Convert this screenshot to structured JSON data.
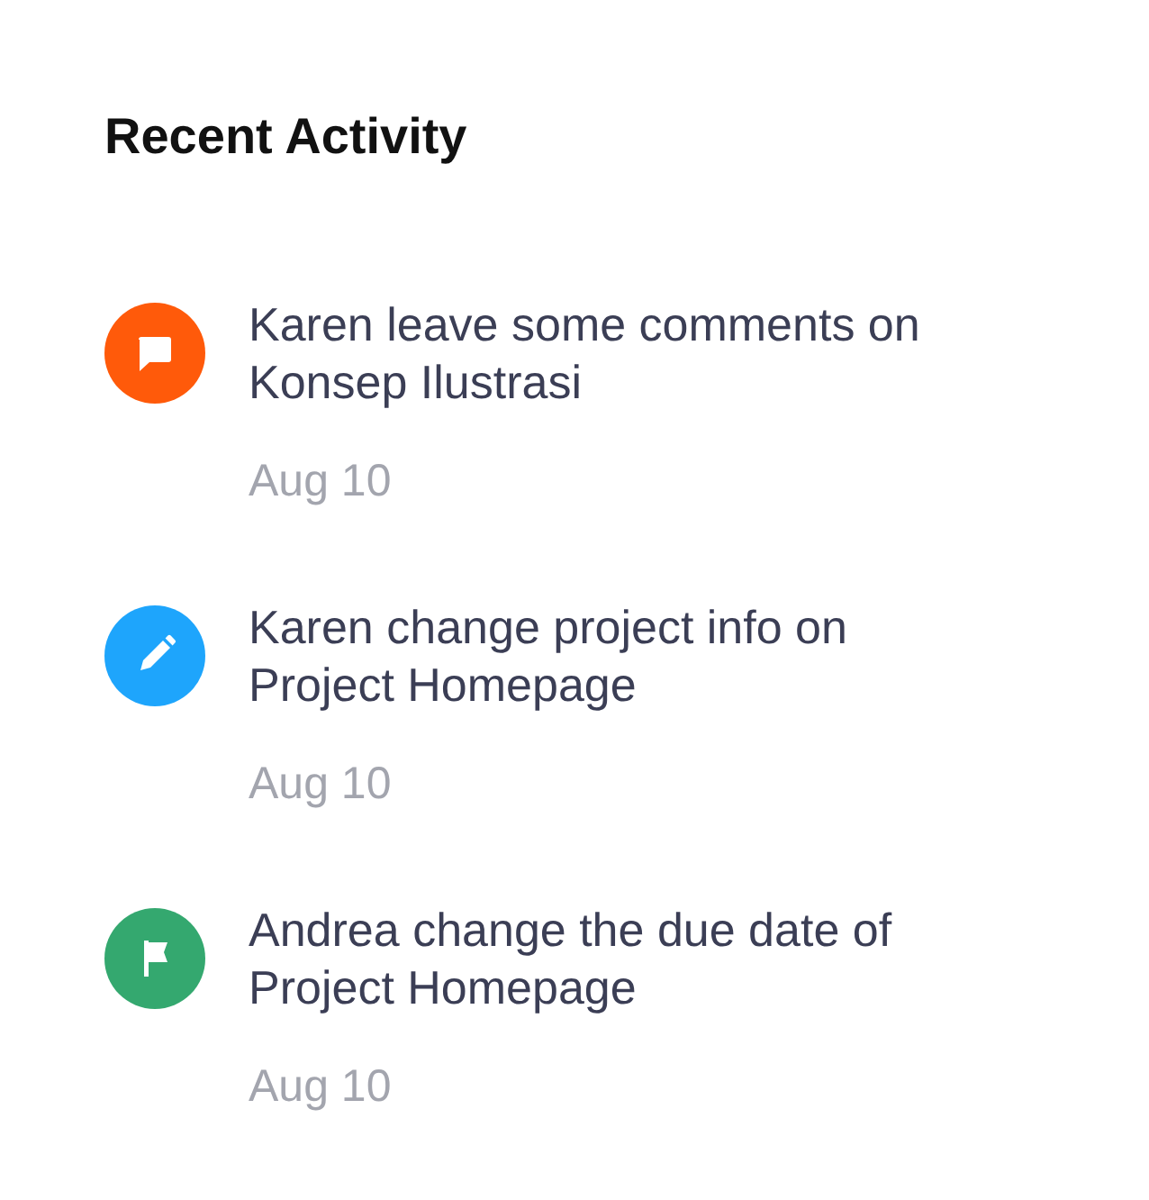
{
  "title": "Recent Activity",
  "activities": [
    {
      "kind": "comment",
      "color": "#ff5a0a",
      "text": "Karen leave some comments on Konsep Ilustrasi",
      "date": "Aug 10"
    },
    {
      "kind": "edit",
      "color": "#1ea5fc",
      "text": "Karen change project info on Project Homepage",
      "date": "Aug 10"
    },
    {
      "kind": "flag",
      "color": "#34a86f",
      "text": "Andrea change the due date of Project Homepage",
      "date": "Aug 10"
    }
  ]
}
